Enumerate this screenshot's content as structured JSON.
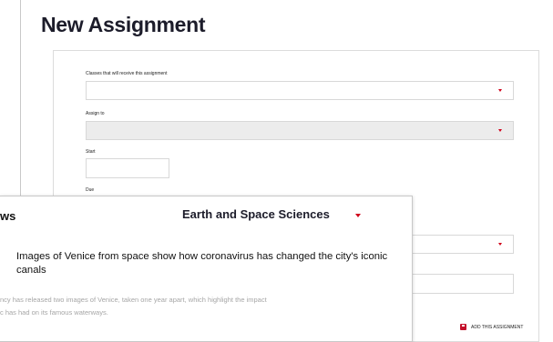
{
  "page": {
    "title": "New Assignment"
  },
  "form": {
    "classes_label": "Classes that will receive this assignment",
    "assign_to_label": "Assign to",
    "start_label": "Start",
    "due_label": "Due",
    "add_button_label": "ADD THIS ASSIGNMENT"
  },
  "news": {
    "heading": "ws",
    "category": "Earth and Space Sciences",
    "article_title": "Images of Venice from space show how coronavirus has changed the city's iconic canals",
    "summary_line1": "ncy has released two images of Venice, taken one year apart, which highlight the impact",
    "summary_line2": "c has had on its famous waterways."
  },
  "colors": {
    "accent": "#d0021b",
    "title_text": "#1c1c2a",
    "disabled_bg": "#ececec"
  },
  "icons": {
    "dropdown": "chevron-down-icon",
    "add": "save-icon"
  }
}
